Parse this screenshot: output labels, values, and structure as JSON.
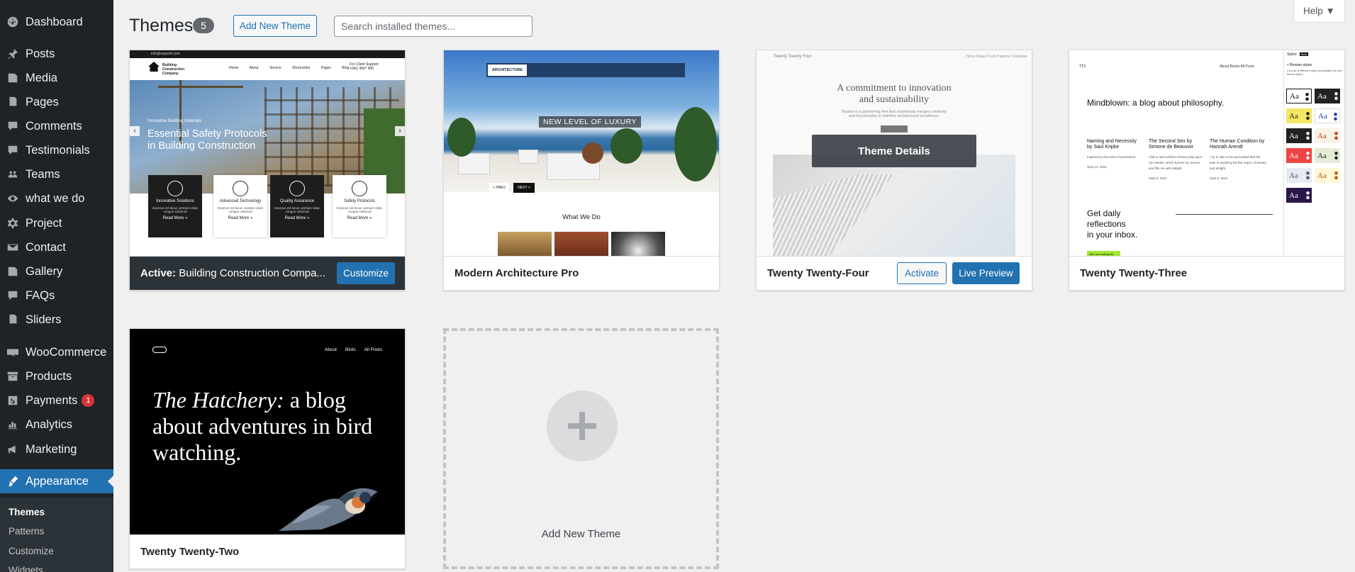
{
  "sidebar": {
    "items": [
      {
        "label": "Dashboard",
        "icon": "dashboard-icon"
      },
      {
        "label": "Posts",
        "icon": "pin-icon"
      },
      {
        "label": "Media",
        "icon": "media-icon"
      },
      {
        "label": "Pages",
        "icon": "pages-icon"
      },
      {
        "label": "Comments",
        "icon": "comment-icon"
      },
      {
        "label": "Testimonials",
        "icon": "comment-icon"
      },
      {
        "label": "Teams",
        "icon": "groups-icon"
      },
      {
        "label": "what we do",
        "icon": "visibility-icon"
      },
      {
        "label": "Project",
        "icon": "gear-icon"
      },
      {
        "label": "Contact",
        "icon": "email-icon"
      },
      {
        "label": "Gallery",
        "icon": "media-icon"
      },
      {
        "label": "FAQs",
        "icon": "comment-icon"
      },
      {
        "label": "Sliders",
        "icon": "pages-icon"
      },
      {
        "label": "WooCommerce",
        "icon": "woo-icon"
      },
      {
        "label": "Products",
        "icon": "archive-icon"
      },
      {
        "label": "Payments",
        "icon": "money-icon",
        "badge": "1"
      },
      {
        "label": "Analytics",
        "icon": "chart-icon"
      },
      {
        "label": "Marketing",
        "icon": "megaphone-icon"
      },
      {
        "label": "Appearance",
        "icon": "brush-icon"
      }
    ],
    "submenu": [
      "Themes",
      "Patterns",
      "Customize",
      "Widgets"
    ]
  },
  "header": {
    "title": "Themes",
    "count": "5",
    "add_new_label": "Add New Theme",
    "search_placeholder": "Search installed themes...",
    "help_label": "Help ▼"
  },
  "themes": {
    "active": {
      "active_prefix": "Active:",
      "name": "Building Construction Compa...",
      "customize_label": "Customize",
      "preview": {
        "nav_brand": "Building Construction Company",
        "nav_links": [
          "Home",
          "About",
          "Service",
          "Shortcodes",
          "Pages",
          "Blog"
        ],
        "support": "For Client Support",
        "phone": "+0A1 4567 905",
        "tagline": "Innovative Building Materials",
        "headline_1": "Essential Safety Protocols",
        "headline_2": "in Building Construction",
        "boxes": [
          "Innovative Solutions",
          "Advanced Technology",
          "Quality Assurance",
          "Safety Protocols"
        ],
        "read_more": "Read More »",
        "email": "info@support.com"
      }
    },
    "architecture": {
      "name": "Modern Architecture Pro",
      "preview": {
        "logo": "ARCHITECTURE",
        "banner": "NEW LEVEL OF LUXURY",
        "section_title": "What We Do",
        "btn_prev": "< PREV",
        "btn_next": "NEXT >"
      }
    },
    "twentyfour": {
      "name": "Twenty Twenty-Four",
      "activate_label": "Activate",
      "preview_label": "Live Preview",
      "details_label": "Theme Details",
      "preview": {
        "site_name": "Twenty Twenty Four",
        "nav": "Home   Pages   Posts   Patterns   Templates",
        "title_1": "A commitment to innovation",
        "title_2": "and sustainability",
        "sub_1": "Études is a pioneering firm that seamlessly merges creativity",
        "sub_2": "and functionality to redefine architectural excellence.",
        "learn": "Learn more"
      }
    },
    "twentythree": {
      "name": "Twenty Twenty-Three",
      "preview": {
        "brand": "TT3",
        "nav": "About   Books   All Posts",
        "title": "Mindblown: a blog about philosophy.",
        "posts": [
          {
            "title": "Naming and Necessity by Saul Kripke",
            "excerpt": "Inspired by this wind of pessimism,",
            "date": "Sept 14, 2021"
          },
          {
            "title": "The Second Sex by Simone de Beauvoir",
            "excerpt": "I felt a cold northern breeze play upon my cheeks, which braces my nerves and fills me with delight.",
            "date": "Sept 6, 2021"
          },
          {
            "title": "The Human Condition by Hannah Arendt",
            "excerpt": "I try in vain to be persuaded that the pole is anything but the region of beauty and delight.",
            "date": "Sept 6, 2021"
          }
        ],
        "daily_1": "Get daily",
        "daily_2": "reflections",
        "daily_3": "in your inbox.",
        "join": "Join our mailing list",
        "panel_styles": "Styles",
        "panel_beta": "Beta",
        "panel_browse": "< Browse styles",
        "panel_hint": "Choose a different style combination for the theme styles",
        "aa": "Aa"
      }
    },
    "twentytwo": {
      "name": "Twenty Twenty-Two",
      "preview": {
        "nav": [
          "About",
          "Birds",
          "All Posts"
        ],
        "headline_em": "The Hatchery:",
        "headline_rest": " a blog about adventures in bird watching."
      }
    },
    "add_new": {
      "label": "Add New Theme"
    }
  },
  "colors": {
    "sidebar_bg": "#1d2327",
    "accent": "#2271b1",
    "badge": "#d63638"
  }
}
